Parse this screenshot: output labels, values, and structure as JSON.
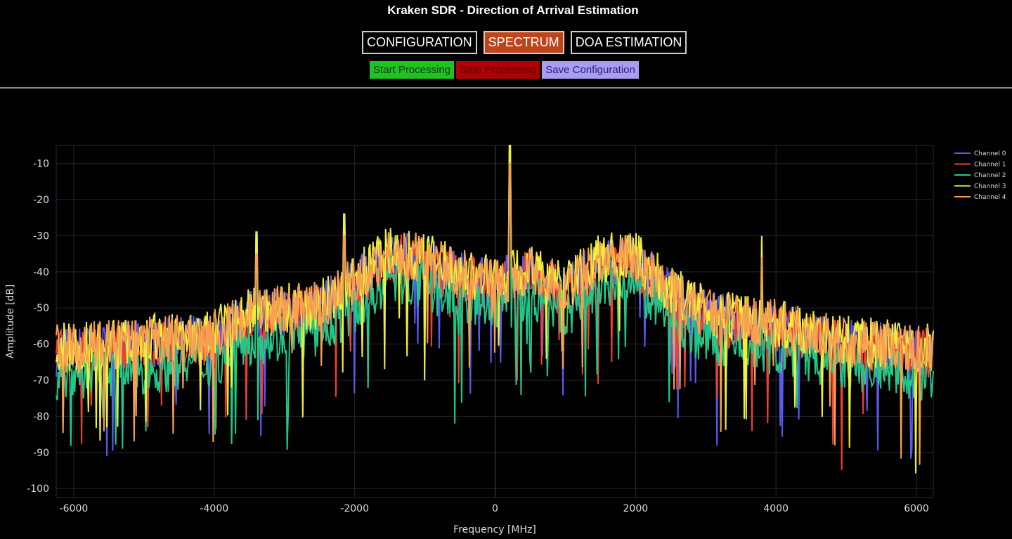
{
  "header": {
    "title": "Kraken SDR - Direction of Arrival Estimation"
  },
  "tabs": [
    {
      "label": "CONFIGURATION",
      "active": false
    },
    {
      "label": "SPECTRUM",
      "active": true
    },
    {
      "label": "DOA ESTIMATION",
      "active": false
    }
  ],
  "actions": [
    {
      "label": "Start Processing",
      "bg": "#1fc21f",
      "fg": "#0a3a0a"
    },
    {
      "label": "Stop Processing",
      "bg": "#b00000",
      "fg": "#5a0000"
    },
    {
      "label": "Save Configuration",
      "bg": "#a99cf5",
      "fg": "#2a2070"
    }
  ],
  "chart_data": {
    "type": "line",
    "xlabel": "Frequency [MHz]",
    "ylabel": "Amplitude [dB]",
    "xlim": [
      -6250,
      6240
    ],
    "ylim": [
      -102.5,
      -5
    ],
    "xticks": [
      -6000,
      -4000,
      -2000,
      0,
      2000,
      4000,
      6000
    ],
    "yticks": [
      -10,
      -20,
      -30,
      -40,
      -50,
      -60,
      -70,
      -80,
      -90,
      -100
    ],
    "grid": true,
    "legend_position": "top-right",
    "envelope_x": [
      -6250,
      -5000,
      -4000,
      -3500,
      -2500,
      -2000,
      -1500,
      -1000,
      -500,
      0,
      500,
      1000,
      1500,
      2000,
      2500,
      3000,
      4000,
      5000,
      6240
    ],
    "envelope_y": [
      -62,
      -60,
      -58,
      -52,
      -50,
      -43,
      -35,
      -37,
      -41,
      -43,
      -40,
      -45,
      -37,
      -37,
      -46,
      -52,
      -55,
      -60,
      -62
    ],
    "peaks": [
      {
        "x": 210,
        "y": -10
      },
      {
        "x": -3400,
        "y": -35
      },
      {
        "x": 3800,
        "y": -36
      },
      {
        "x": -2150,
        "y": -30
      }
    ],
    "series": [
      {
        "name": "Channel 0",
        "color": "#5a5af0",
        "offset": 0
      },
      {
        "name": "Channel 1",
        "color": "#ef4032",
        "offset": -1
      },
      {
        "name": "Channel 2",
        "color": "#22c88a",
        "offset": -7
      },
      {
        "name": "Channel 3",
        "color": "#f0f03a",
        "offset": 1
      },
      {
        "name": "Channel 4",
        "color": "#f7a050",
        "offset": 0.5
      }
    ]
  }
}
